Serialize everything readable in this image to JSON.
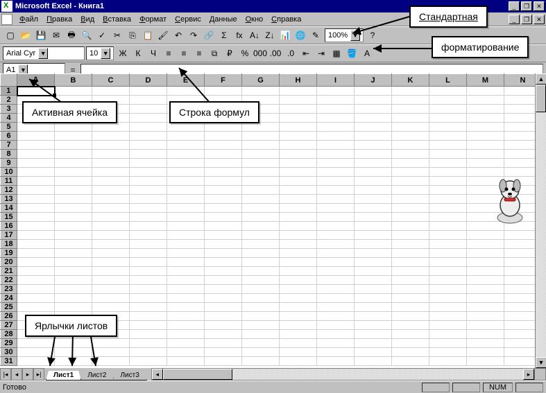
{
  "title": "Microsoft Excel - Книга1",
  "menu": [
    "Файл",
    "Правка",
    "Вид",
    "Вставка",
    "Формат",
    "Сервис",
    "Данные",
    "Окно",
    "Справка"
  ],
  "zoom": "100%",
  "font_name": "Arial Cyr",
  "font_size": "10",
  "name_box": "A1",
  "columns": [
    "A",
    "B",
    "C",
    "D",
    "E",
    "F",
    "G",
    "H",
    "I",
    "J",
    "K",
    "L",
    "M",
    "N"
  ],
  "row_count": 31,
  "active_cell": {
    "col": 0,
    "row": 0
  },
  "sheets": [
    "Лист1",
    "Лист2",
    "Лист3"
  ],
  "active_sheet": 0,
  "status": "Готово",
  "indicator_num": "NUM",
  "callouts": {
    "standard": "Стандартная",
    "formatting": "форматирование",
    "active_cell": "Активная ячейка",
    "formula_bar": "Строка формул",
    "sheet_tabs": "Ярлычки листов"
  },
  "std_icons": [
    "new",
    "open",
    "save",
    "mail",
    "print",
    "preview",
    "spell",
    "cut",
    "copy",
    "paste",
    "fmt-paint",
    "undo",
    "redo",
    "link",
    "autosum",
    "fx",
    "sort-asc",
    "sort-desc",
    "chart",
    "map",
    "drawing"
  ],
  "fmt_icons": [
    "bold",
    "italic",
    "underline",
    "align-left",
    "align-center",
    "align-right",
    "merge",
    "currency",
    "percent",
    "comma",
    "inc-dec",
    "dec-dec",
    "dec-indent",
    "inc-indent",
    "borders",
    "fill-color",
    "font-color"
  ]
}
